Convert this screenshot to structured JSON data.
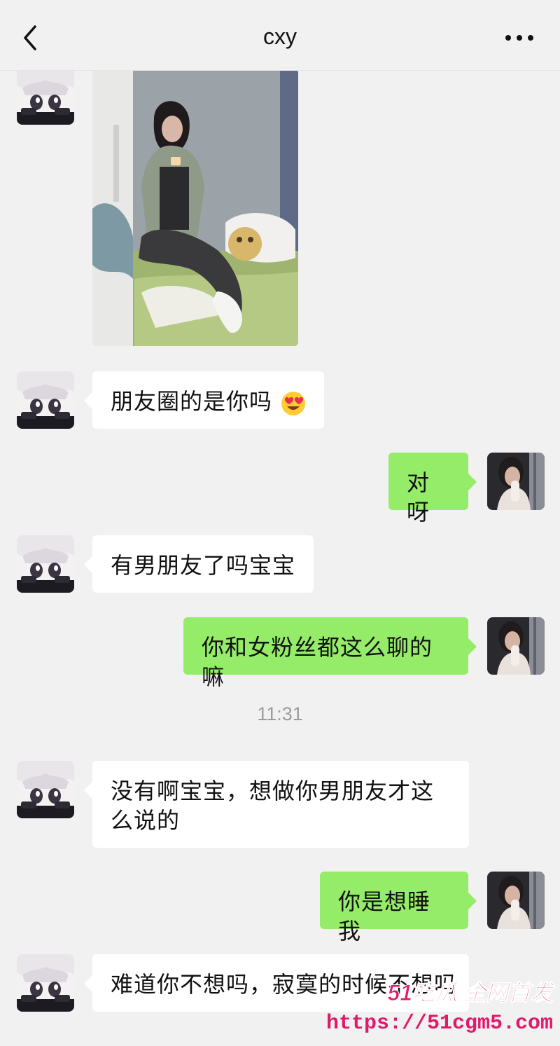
{
  "header": {
    "title": "cxy"
  },
  "messages": [
    {
      "side": "left",
      "type": "image"
    },
    {
      "side": "left",
      "type": "text",
      "text": "朋友圈的是你吗"
    },
    {
      "side": "right",
      "type": "text",
      "text": "对呀"
    },
    {
      "side": "left",
      "type": "text",
      "text": "有男朋友了吗宝宝"
    },
    {
      "side": "right",
      "type": "text",
      "text": "你和女粉丝都这么聊的嘛"
    },
    {
      "side": "left",
      "type": "text",
      "text": "没有啊宝宝，想做你男朋友才这么说的"
    },
    {
      "side": "right",
      "type": "text",
      "text": "你是想睡我"
    },
    {
      "side": "left",
      "type": "text",
      "text": "难道你不想吗，寂寞的时候不想吗"
    }
  ],
  "timestamp": "11:31",
  "watermark": {
    "brand": "51吃瓜 全网首发",
    "url": "https://51cgm5.com"
  },
  "icons": [
    "back-arrow-icon",
    "more-dots-icon",
    "heart-eyes-emoji-icon"
  ],
  "colors": {
    "background": "#f1f1f1",
    "sent_bubble": "#95ec69",
    "received_bubble": "#ffffff",
    "watermark": "#e0196a"
  }
}
